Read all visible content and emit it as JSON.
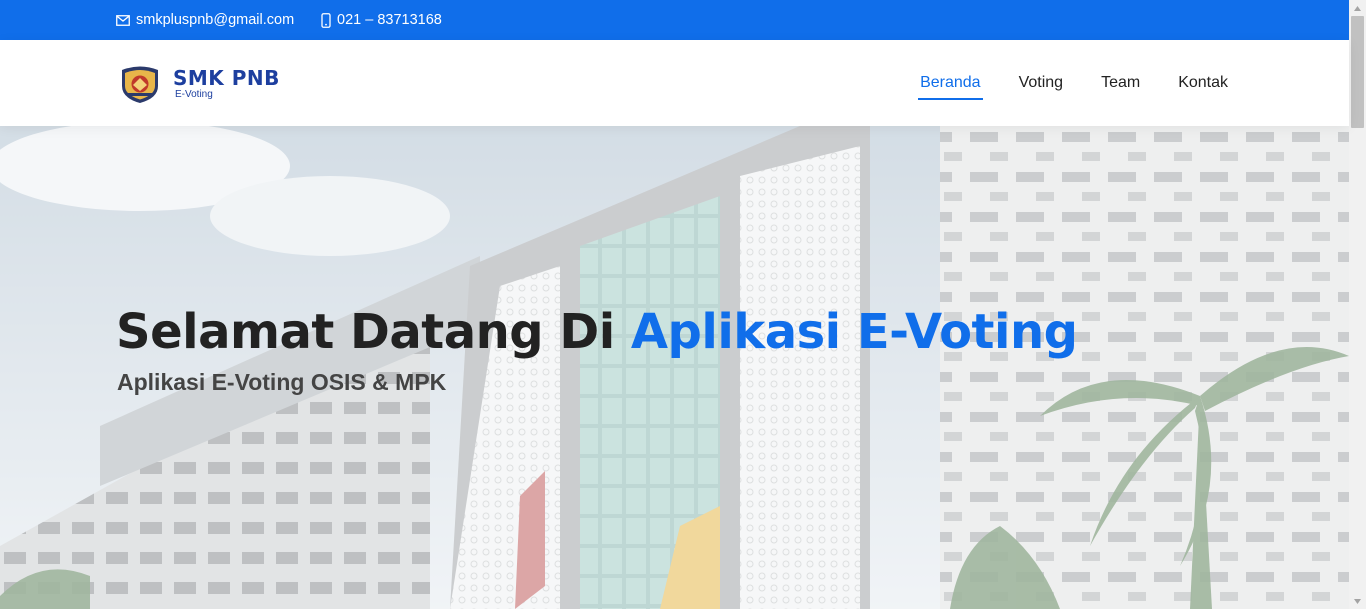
{
  "topbar": {
    "email": "smkpluspnb@gmail.com",
    "phone": "021 – 83713168",
    "email_icon": "envelope-icon",
    "phone_icon": "phone-icon"
  },
  "header": {
    "logo": {
      "name": "SMK PNB",
      "subtitle": "E-Voting"
    },
    "nav": [
      {
        "label": "Beranda",
        "active": true
      },
      {
        "label": "Voting",
        "active": false
      },
      {
        "label": "Team",
        "active": false
      },
      {
        "label": "Kontak",
        "active": false
      }
    ]
  },
  "hero": {
    "title_prefix": "Selamat Datang Di",
    "title_accent": "Aplikasi E-Voting",
    "subtitle": "Aplikasi E-Voting OSIS & MPK"
  },
  "colors": {
    "primary": "#106eea",
    "heading": "#222222",
    "logo_blue": "#1d3f9f"
  }
}
